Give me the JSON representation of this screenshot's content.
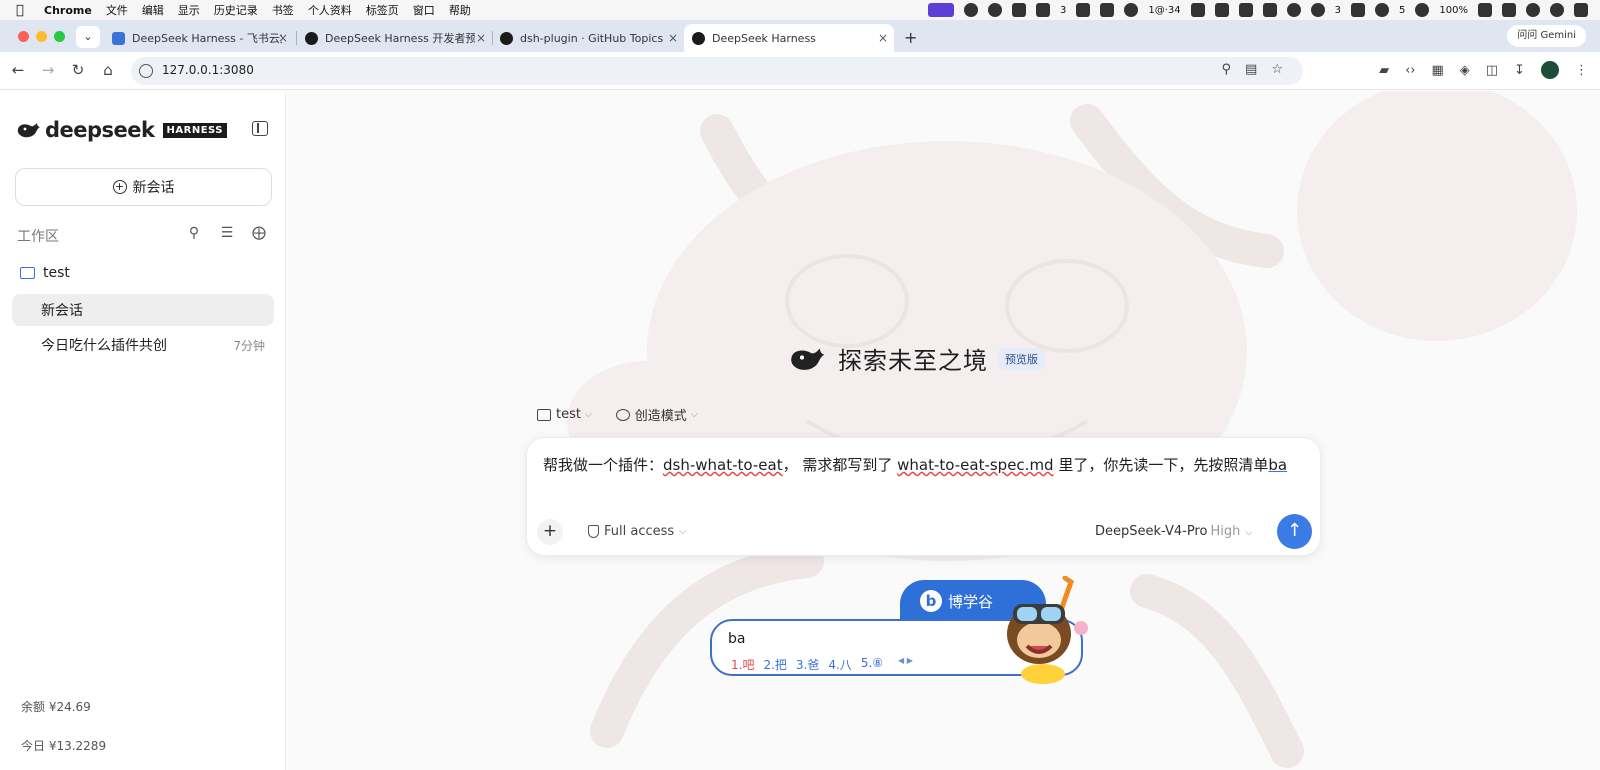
{
  "menubar": {
    "app_name": "Chrome",
    "menus": [
      "文件",
      "编辑",
      "显示",
      "历史记录",
      "书签",
      "个人资料",
      "标签页",
      "窗口",
      "帮助"
    ],
    "status_texts": [
      "3",
      "1@·34",
      "3",
      "5",
      "100%"
    ]
  },
  "tabs": [
    {
      "title": "DeepSeek Harness - 飞书云文",
      "favicon_color": "#3a72d8"
    },
    {
      "title": "DeepSeek Harness 开发者预览",
      "favicon_color": "#1b1b1b"
    },
    {
      "title": "dsh-plugin · GitHub Topics",
      "favicon_color": "#1b1b1b"
    },
    {
      "title": "DeepSeek Harness",
      "favicon_color": "#1b1b1b"
    }
  ],
  "browser": {
    "url": "127.0.0.1:3080",
    "gemini_label": "问问 Gemini"
  },
  "sidebar": {
    "brand_name": "deepseek",
    "brand_tag": "HARNESS",
    "new_chat_label": "新会话",
    "workspace_label": "工作区",
    "folder_name": "test",
    "conversations": [
      {
        "title": "新会话",
        "time": ""
      },
      {
        "title": "今日吃什么插件共创",
        "time": "7分钟"
      }
    ],
    "balance_label": "余额 ¥24.69",
    "today_label": "今日 ¥13.2289"
  },
  "main": {
    "hero_title": "探索未至之境",
    "hero_badge": "预览版",
    "context_folder": "test",
    "context_mode": "创造模式",
    "composer": {
      "text_prefix": "帮我做一个插件：",
      "text_plugin": "dsh-what-to-eat",
      "text_mid": "， 需求都写到了 ",
      "text_spec": "what-to-eat-spec.md",
      "text_suffix": " 里了，你先读一下，先按照清单",
      "text_composing": "ba",
      "access_label": "Full access",
      "model_name": "DeepSeek-V4-Pro",
      "model_level": "High",
      "attach_icon": "+",
      "send_icon": "↑"
    }
  },
  "ime": {
    "brand": "博学谷",
    "preedit": "ba",
    "candidates": [
      "1.吧",
      "2.把",
      "3.爸",
      "4.八",
      "5.⑧"
    ]
  },
  "colors": {
    "accent": "#3b7be6",
    "ime_blue": "#2f6fd8",
    "folder_blue": "#3a72d8"
  }
}
